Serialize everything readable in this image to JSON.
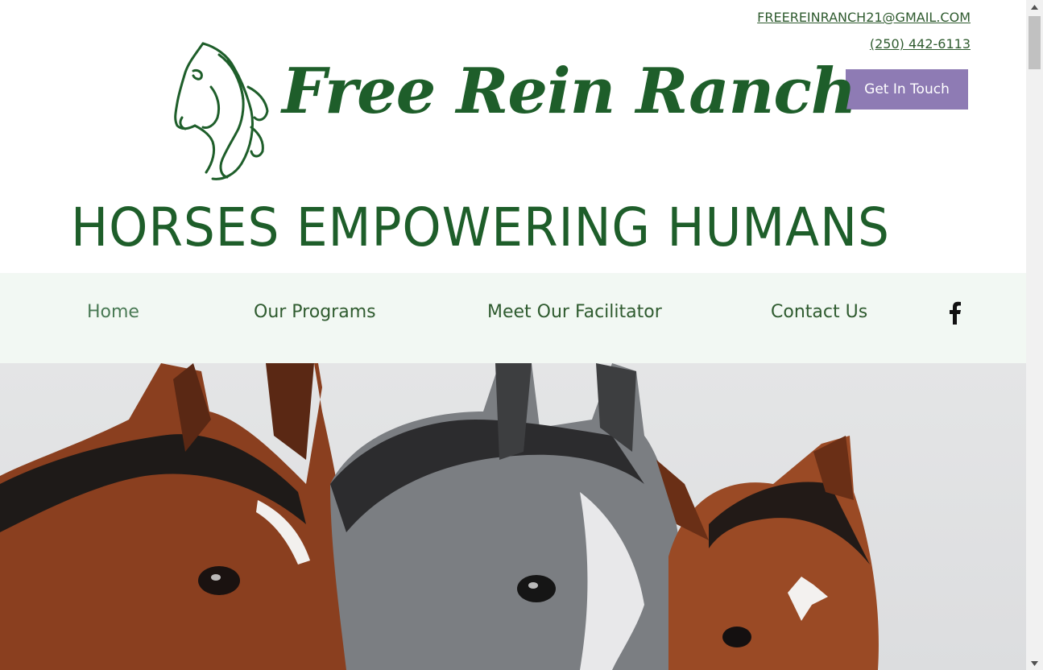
{
  "header": {
    "email": "FREEREINRANCH21@GMAIL.COM",
    "phone": "(250) 442-6113",
    "cta_label": "Get In Touch"
  },
  "logo": {
    "text": "Free Rein Ranch"
  },
  "tagline": "HORSES EMPOWERING HUMANS",
  "nav": {
    "items": [
      {
        "label": "Home"
      },
      {
        "label": "Our Programs"
      },
      {
        "label": "Meet Our Facilitator"
      },
      {
        "label": "Contact Us"
      }
    ],
    "social_icon": "facebook-icon"
  },
  "colors": {
    "brand_green": "#1e5e2a",
    "nav_bg": "#f2f8f3",
    "cta_purple": "#8e7bb4"
  }
}
